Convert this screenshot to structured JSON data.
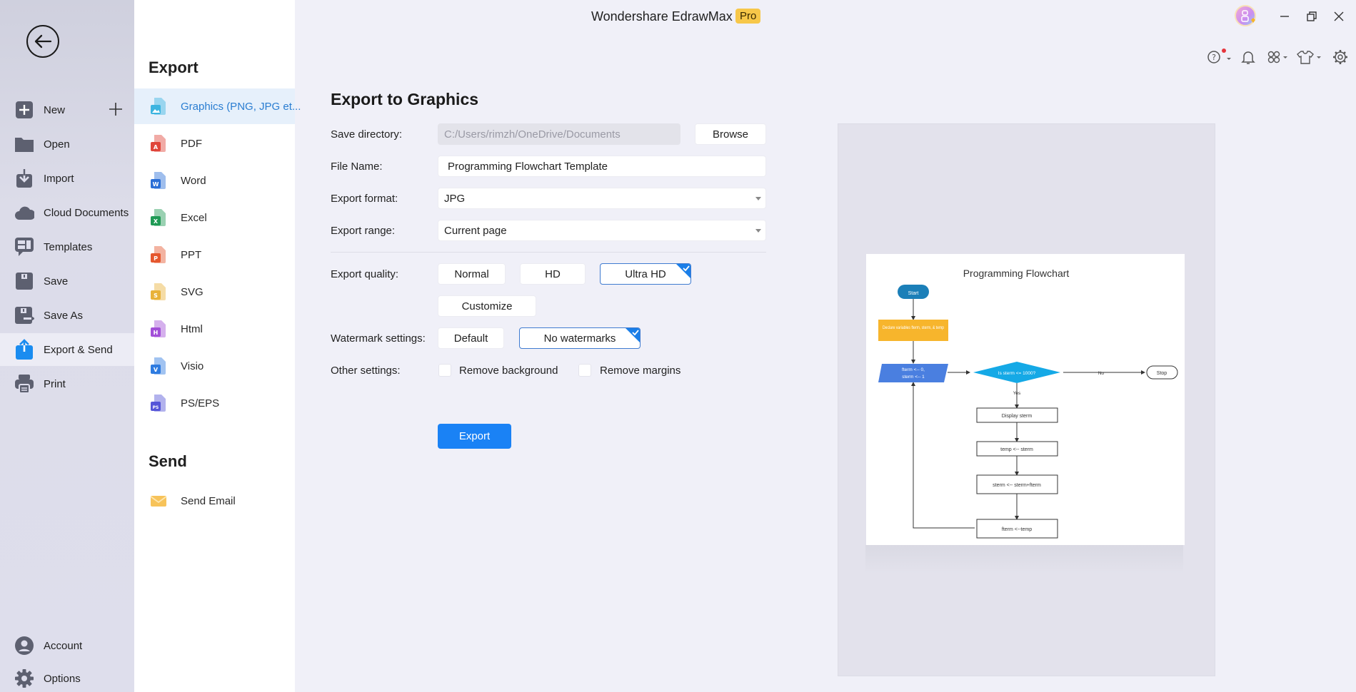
{
  "app": {
    "title": "Wondershare EdrawMax",
    "badge": "Pro",
    "window_controls": [
      "minimize-icon",
      "restore-icon",
      "close-icon"
    ],
    "toolbar_icons": [
      "help-icon",
      "bell-icon",
      "apps-grid-icon",
      "shirt-theme-icon",
      "gear-icon"
    ]
  },
  "leftnav": {
    "back_icon": "arrow-left-icon",
    "items": [
      {
        "label": "New",
        "icon": "plus-square-icon"
      },
      {
        "label": "Open",
        "icon": "folder-icon"
      },
      {
        "label": "Import",
        "icon": "import-icon"
      },
      {
        "label": "Cloud Documents",
        "icon": "cloud-icon"
      },
      {
        "label": "Templates",
        "icon": "templates-icon"
      },
      {
        "label": "Save",
        "icon": "save-icon"
      },
      {
        "label": "Save As",
        "icon": "save-as-icon"
      },
      {
        "label": "Export & Send",
        "icon": "export-icon",
        "active": true
      },
      {
        "label": "Print",
        "icon": "printer-icon"
      }
    ],
    "bottom_items": [
      {
        "label": "Account",
        "icon": "user-icon"
      },
      {
        "label": "Options",
        "icon": "gear-icon"
      }
    ]
  },
  "midpanel": {
    "export_heading": "Export",
    "export_items": [
      {
        "label": "Graphics (PNG, JPG et...",
        "color": "#3cb4e0",
        "letter": "",
        "active": true
      },
      {
        "label": "PDF",
        "color": "#e0453a",
        "letter": "A"
      },
      {
        "label": "Word",
        "color": "#2b6fd6",
        "letter": "W"
      },
      {
        "label": "Excel",
        "color": "#1f9a55",
        "letter": "X"
      },
      {
        "label": "PPT",
        "color": "#e5572e",
        "letter": "P"
      },
      {
        "label": "SVG",
        "color": "#e8b23a",
        "letter": "S"
      },
      {
        "label": "Html",
        "color": "#a24fd8",
        "letter": "H"
      },
      {
        "label": "Visio",
        "color": "#2e7be0",
        "letter": "V"
      },
      {
        "label": "PS/EPS",
        "color": "#5555d8",
        "letter": "PS"
      }
    ],
    "send_heading": "Send",
    "send_items": [
      {
        "label": "Send Email",
        "color": "#f7c35a"
      }
    ]
  },
  "form": {
    "title": "Export to Graphics",
    "save_directory": {
      "label": "Save directory:",
      "value": "C:/Users/rimzh/OneDrive/Documents",
      "browse": "Browse"
    },
    "file_name": {
      "label": "File Name:",
      "value": "Programming Flowchart Template"
    },
    "export_format": {
      "label": "Export format:",
      "value": "JPG"
    },
    "export_range": {
      "label": "Export range:",
      "value": "Current page"
    },
    "export_quality": {
      "label": "Export quality:",
      "options": [
        "Normal",
        "HD",
        "Ultra HD",
        "Customize"
      ],
      "selected": "Ultra HD"
    },
    "watermark": {
      "label": "Watermark settings:",
      "options": [
        "Default",
        "No watermarks"
      ],
      "selected": "No watermarks"
    },
    "other": {
      "label": "Other settings:",
      "remove_background": {
        "label": "Remove background",
        "checked": false
      },
      "remove_margins": {
        "label": "Remove margins",
        "checked": false
      }
    },
    "export_button": "Export"
  },
  "preview": {
    "title": "Programming Flowchart",
    "nodes": {
      "start": "Start",
      "declare": "Declare variables fterm, sterm, & temp",
      "init_1": "fterm <-- 0,",
      "init_2": "sterm <-- 1",
      "decision": "Is sterm <= 1000?",
      "stop": "Stop",
      "display": "Display sterm",
      "temp": "temp <-- sterm",
      "sum": "sterm <-- sterm+fterm",
      "fterm": "fterm <--temp"
    },
    "edge_labels": {
      "no": "No",
      "yes": "Yes"
    },
    "colors": {
      "start": "#1b7fb8",
      "declare": "#f7b52c",
      "init": "#4a7fe0",
      "decision": "#15a9e6"
    }
  },
  "colors": {
    "accent": "#1a82f5",
    "selected_border": "#3f7bd0",
    "active_text": "#2a7dd1"
  }
}
